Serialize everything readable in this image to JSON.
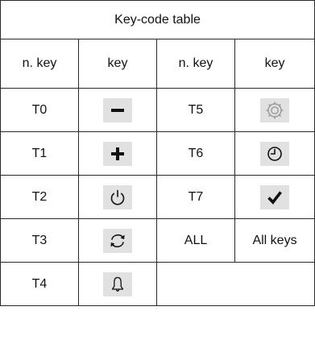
{
  "table": {
    "title": "Key-code table",
    "headers": [
      "n. key",
      "key",
      "n. key",
      "key"
    ],
    "rows": [
      {
        "left_code": "T0",
        "left_icon": "minus-icon",
        "right_code": "T5",
        "right_icon": "settings-gear-icon"
      },
      {
        "left_code": "T1",
        "left_icon": "plus-icon",
        "right_code": "T6",
        "right_icon": "clock-icon"
      },
      {
        "left_code": "T2",
        "left_icon": "power-icon",
        "right_code": "T7",
        "right_icon": "checkmark-icon"
      },
      {
        "left_code": "T3",
        "left_icon": "refresh-cycle-icon",
        "right_code": "ALL",
        "right_text": "All keys"
      },
      {
        "left_code": "T4",
        "left_icon": "bell-icon"
      }
    ]
  },
  "colors": {
    "border": "#2a2a2a",
    "key_background": "#e1e1e1",
    "icon_dark": "#111111",
    "icon_light": "#9a9a9a"
  }
}
